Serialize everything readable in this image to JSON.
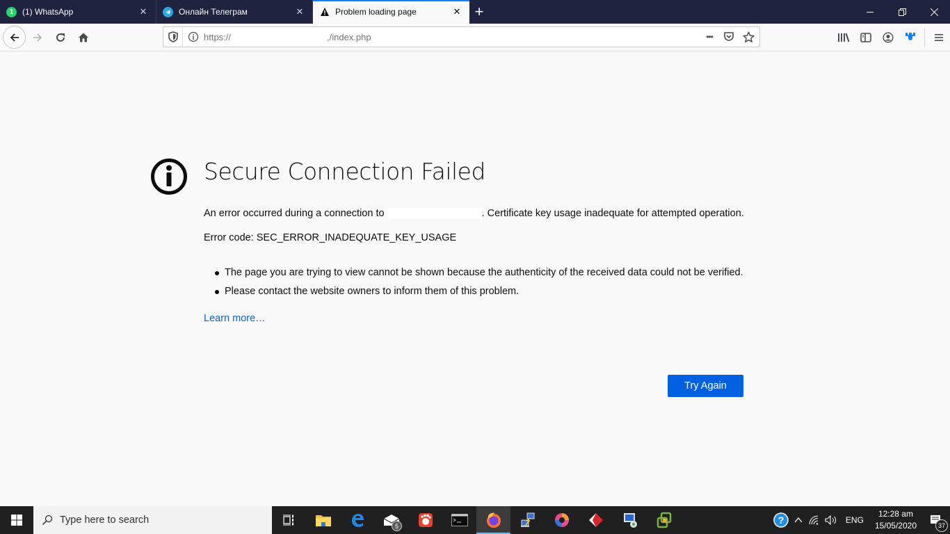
{
  "browser": {
    "tabs": [
      {
        "title": "(1) WhatsApp",
        "icon": "whatsapp-icon",
        "icon_text": "1",
        "icon_color": "#25d366",
        "active": false
      },
      {
        "title": "Онлайн Телеграм",
        "icon": "telegram-icon",
        "icon_color": "#2ca5e0",
        "active": false
      },
      {
        "title": "Problem loading page",
        "icon": "warning-icon",
        "active": true
      }
    ],
    "new_tab_label": "+",
    "window_controls": {
      "minimize": "—",
      "restore": "❐",
      "close": "✕"
    },
    "url": {
      "scheme": "https://",
      "path": ",/index.php"
    },
    "page_actions_label": "•••"
  },
  "error_page": {
    "title": "Secure Connection Failed",
    "message_before": "An error occurred during a connection to ",
    "message_after": ". Certificate key usage inadequate for attempted operation.",
    "error_code_label": "Error code: SEC_ERROR_INADEQUATE_KEY_USAGE",
    "bullets": [
      "The page you are trying to view cannot be shown because the authenticity of the received data could not be verified.",
      "Please contact the website owners to inform them of this problem."
    ],
    "learn_more": "Learn more…",
    "try_again": "Try Again",
    "accent_color": "#0060df"
  },
  "taskbar": {
    "search_placeholder": "Type here to search",
    "apps": [
      {
        "name": "task-view"
      },
      {
        "name": "file-explorer"
      },
      {
        "name": "edge"
      },
      {
        "name": "mail",
        "badge": "5"
      },
      {
        "name": "app-red"
      },
      {
        "name": "command-prompt"
      },
      {
        "name": "firefox",
        "active": true
      },
      {
        "name": "network-connect"
      },
      {
        "name": "app-swirl"
      },
      {
        "name": "app-diamond"
      },
      {
        "name": "remote-desktop"
      },
      {
        "name": "vmware"
      }
    ],
    "tray": {
      "language": "ENG",
      "time": "12:28 am",
      "date": "15/05/2020",
      "notification_count": "37"
    }
  }
}
